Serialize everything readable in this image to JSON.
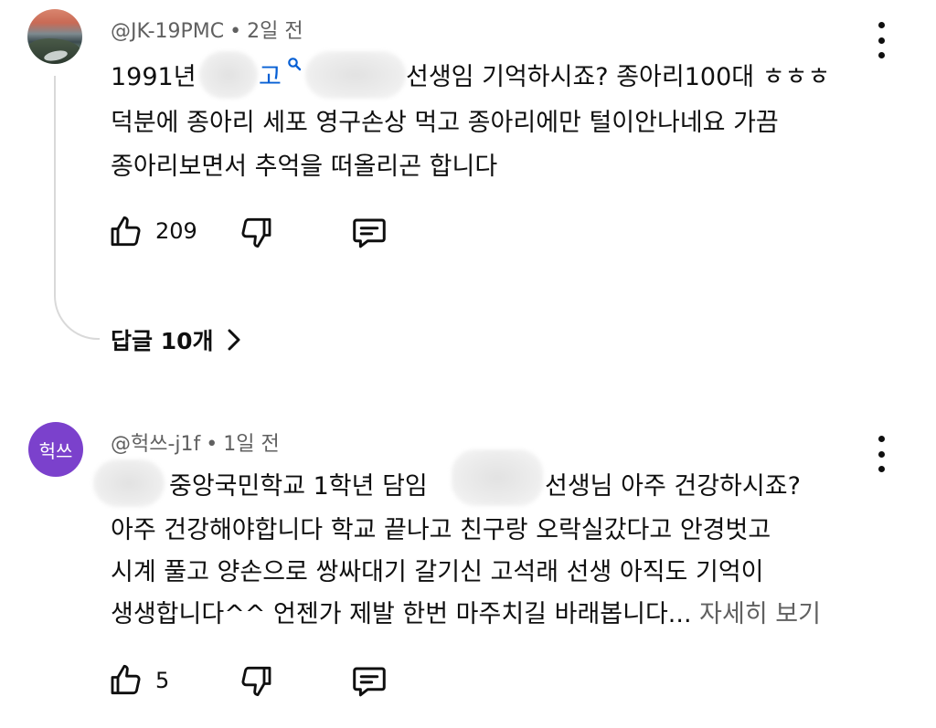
{
  "comments": [
    {
      "author": "@JK-19PMC",
      "age": "2일 전",
      "line1_a": "1991년",
      "line1_link": "고",
      "line1_b": "선생임 기억하시죠? 종아리100대 ㅎㅎㅎ",
      "line2": "덕분에 종아리 세포 영구손상 먹고 종아리에만 털이안나네요 가끔",
      "line3": "종아리보면서 추억을 떠올리곤 합니다",
      "likes": "209",
      "replies_label": "답글 10개"
    },
    {
      "author": "@헉쓰-j1f",
      "age": "1일 전",
      "avatar_text": "헉쓰",
      "line1_a": "중앙국민학교 1학년 담임",
      "line1_b": "선생님 아주 건강하시죠?",
      "line2": "아주 건강해야합니다 학교 끝나고 친구랑 오락실갔다고 안경벗고",
      "line3": "시계 풀고 양손으로 쌍싸대기 갈기신 고석래 선생 아직도 기억이",
      "line4": "생생합니다^^ 언젠가 제발 한번 마주치길 바래봅니다...",
      "more_label": "자세히 보기",
      "likes": "5"
    }
  ],
  "meta_separator": "•",
  "icons": [
    "thumbs-up-icon",
    "thumbs-down-icon",
    "reply-icon",
    "more-vert-icon",
    "search-icon",
    "chevron-right-icon"
  ],
  "colors": {
    "link": "#065fd4",
    "avatar_purple": "#7b41cc",
    "muted": "#606060"
  }
}
